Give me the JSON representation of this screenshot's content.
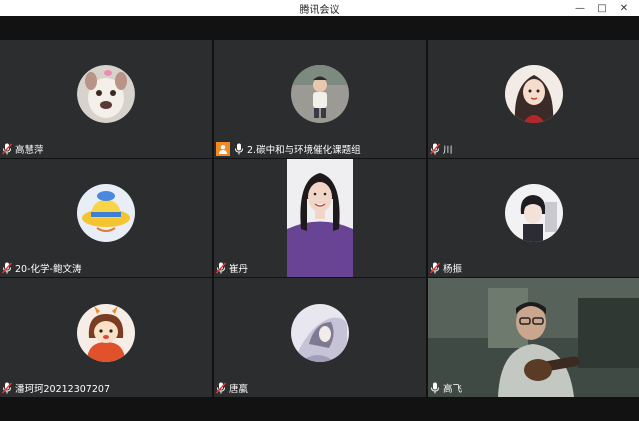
{
  "window": {
    "title": "腾讯会议",
    "controls": [
      "minimize-icon",
      "maximize-icon",
      "close-icon"
    ]
  },
  "participants": [
    {
      "name": "高慧萍",
      "display": "avatar",
      "avatar_icon": "dog-avatar-icon",
      "mic": "muted"
    },
    {
      "name": "2.碳中和与环境催化课题组",
      "display": "avatar",
      "avatar_icon": "child-photo-avatar-icon",
      "mic": "on",
      "host": true
    },
    {
      "name": "川",
      "display": "avatar",
      "avatar_icon": "cartoon-girl-avatar-icon",
      "mic": "muted"
    },
    {
      "name": "20-化学-鲍文涛",
      "display": "avatar",
      "avatar_icon": "cartoon-hat-avatar-icon",
      "mic": "muted"
    },
    {
      "name": "崔丹",
      "display": "video",
      "mic": "muted"
    },
    {
      "name": "杨振",
      "display": "avatar",
      "avatar_icon": "anime-boy-avatar-icon",
      "mic": "muted"
    },
    {
      "name": "潘珂珂20212307207",
      "display": "avatar",
      "avatar_icon": "cartoon-girl-orange-avatar-icon",
      "mic": "muted"
    },
    {
      "name": "唐嬴",
      "display": "avatar",
      "avatar_icon": "anime-art-avatar-icon",
      "mic": "muted"
    },
    {
      "name": "高飞",
      "display": "video",
      "mic": "on"
    }
  ],
  "colors": {
    "tile_bg": "#2b2d2f",
    "bar_bg": "#121212",
    "host_badge": "#f08a24"
  }
}
